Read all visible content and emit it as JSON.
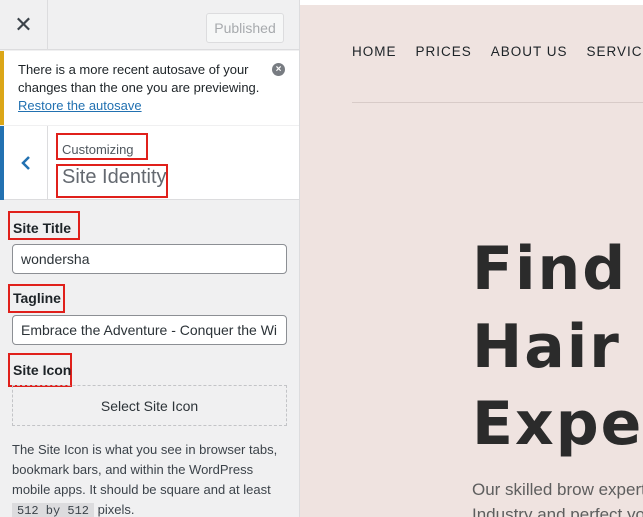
{
  "topbar": {
    "close_symbol": "✕",
    "publish_label": "Published"
  },
  "notice": {
    "message": "There is a more recent autosave of your changes than the one you are previewing.",
    "link": "Restore the autosave",
    "dismiss_icon": "dismiss-circle-icon"
  },
  "section": {
    "parent_label": "Customizing",
    "title": "Site Identity",
    "back_icon": "chevron-left-icon"
  },
  "fields": {
    "site_title_label": "Site Title",
    "site_title_value": "wondersha",
    "tagline_label": "Tagline",
    "tagline_value": "Embrace the Adventure - Conquer the Wi",
    "site_icon_label": "Site Icon",
    "select_icon_button": "Select Site Icon"
  },
  "site_icon_help": {
    "text_before": "The Site Icon is what you see in browser tabs, bookmark bars, and within the WordPress mobile apps. It should be square and at least",
    "code": "512 by 512",
    "text_after": "pixels."
  },
  "preview": {
    "nav": [
      "HOME",
      "PRICES",
      "ABOUT US",
      "SERVICES"
    ],
    "hero_lines": [
      "Find Y",
      "Hair c",
      "Exper"
    ],
    "sub_lines": [
      "Our skilled brow expert",
      "Industry and perfect yo"
    ]
  },
  "colors": {
    "accent": "#2271b1",
    "notice_border": "#dba617",
    "highlight": "#e0201b",
    "preview_bg": "#efe3e0"
  }
}
